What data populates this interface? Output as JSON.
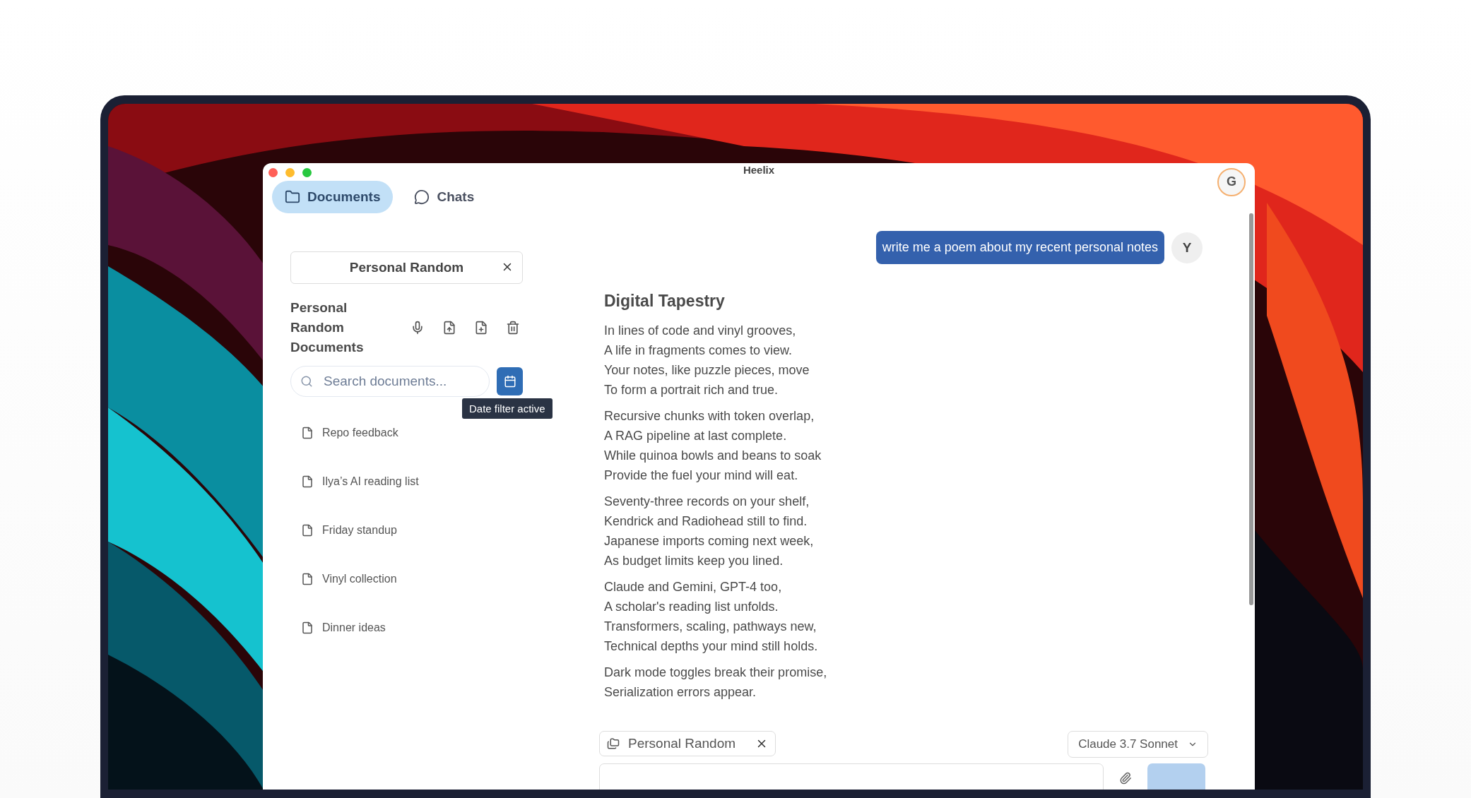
{
  "window": {
    "title": "Heelix"
  },
  "tabs": [
    {
      "label": "Documents",
      "selected": true
    },
    {
      "label": "Chats",
      "selected": false
    }
  ],
  "account": {
    "initial": "G"
  },
  "sidebar": {
    "collection_chip": {
      "label": "Personal Random"
    },
    "heading": "Personal Random Documents",
    "search": {
      "placeholder": "Search documents..."
    },
    "date_filter": {
      "active": true,
      "tooltip": "Date filter active"
    },
    "documents": [
      {
        "title": "Repo feedback"
      },
      {
        "title": "Ilya’s AI reading list"
      },
      {
        "title": "Friday standup"
      },
      {
        "title": "Vinyl collection"
      },
      {
        "title": "Dinner ideas"
      }
    ]
  },
  "chat": {
    "messages": [
      {
        "kind": "prompt",
        "text": "write me a poem about my recent personal notes",
        "avatar": "Y"
      },
      {
        "kind": "reply",
        "title": "Digital Tapestry",
        "stanzas": [
          [
            "In lines of code and vinyl grooves,",
            "A life in fragments comes to view.",
            "Your notes, like puzzle pieces, move",
            "To form a portrait rich and true."
          ],
          [
            "Recursive chunks with token overlap,",
            "A RAG pipeline at last complete.",
            "While quinoa bowls and beans to soak",
            "Provide the fuel your mind will eat."
          ],
          [
            "Seventy-three records on your shelf,",
            "Kendrick and Radiohead still to find.",
            "Japanese imports coming next week,",
            "As budget limits keep you lined."
          ],
          [
            "Claude and Gemini, GPT-4 too,",
            "A scholar's reading list unfolds.",
            "Transformers, scaling, pathways new,",
            "Technical depths your mind still holds."
          ],
          [
            "Dark mode toggles break their promise,",
            "Serialization errors appear."
          ]
        ]
      }
    ],
    "context_chip": {
      "label": "Personal Random"
    },
    "model_select": {
      "value": "Claude 3.7 Sonnet"
    }
  }
}
